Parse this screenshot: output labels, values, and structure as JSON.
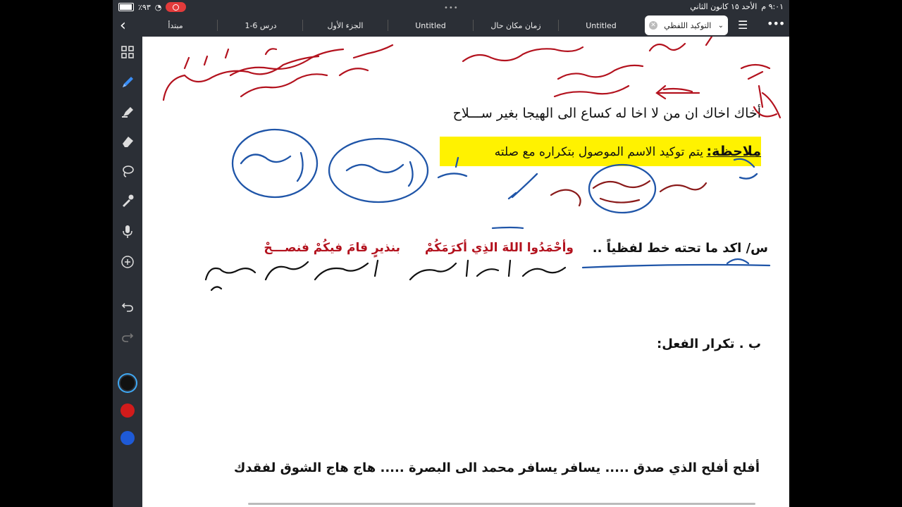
{
  "status": {
    "time": "٩:٠١ م",
    "date": "الأحد ١٥ كانون الثاني",
    "battery": "٪٩٣",
    "battery_level": 0.93
  },
  "tabs": [
    {
      "label": "مبتدأ"
    },
    {
      "label": "درس 6-1"
    },
    {
      "label": "الجزء الأول"
    },
    {
      "label": "Untitled"
    },
    {
      "label": "زمان مكان حال"
    },
    {
      "label": "Untitled"
    }
  ],
  "active_tab": {
    "label": "التوكيد اللفظي"
  },
  "tools": [
    "grid-icon",
    "pen-icon",
    "highlighter-icon",
    "eraser-icon",
    "lasso-icon",
    "pipette-icon",
    "mic-icon",
    "add-icon",
    "undo-icon",
    "redo-icon"
  ],
  "colors": {
    "ink_red": "#b3121e",
    "ink_blue": "#1f55a8",
    "highlight": "#fff200",
    "swatch_black": "#111111",
    "swatch_red": "#d21b1b",
    "swatch_blue": "#1e5ad6"
  },
  "document": {
    "verse": "أخاك اخاك ان من لا اخا له      كساع الى الهيجا بغير ســـلاح",
    "note_label": "ملاحظة:",
    "note_text": "يتم توكيد الاسم الموصول بتكراره مع صلته",
    "question_label": "س/ اكد ما تحته خط لفظياً ..",
    "question_part1": "وأحْمَدُوا اللهَ الذِي أكرَمَكُمْ",
    "question_part2": "بنذيرٍ قامَ فيكُمْ فنصـــحْ",
    "section_b": "ب . تكرار الفعل:",
    "examples": "أفلح أفلح الذي صدق     .....     يسافر يسافر محمد الى البصرة     .....   هاج هاج الشوق لفقدك"
  }
}
